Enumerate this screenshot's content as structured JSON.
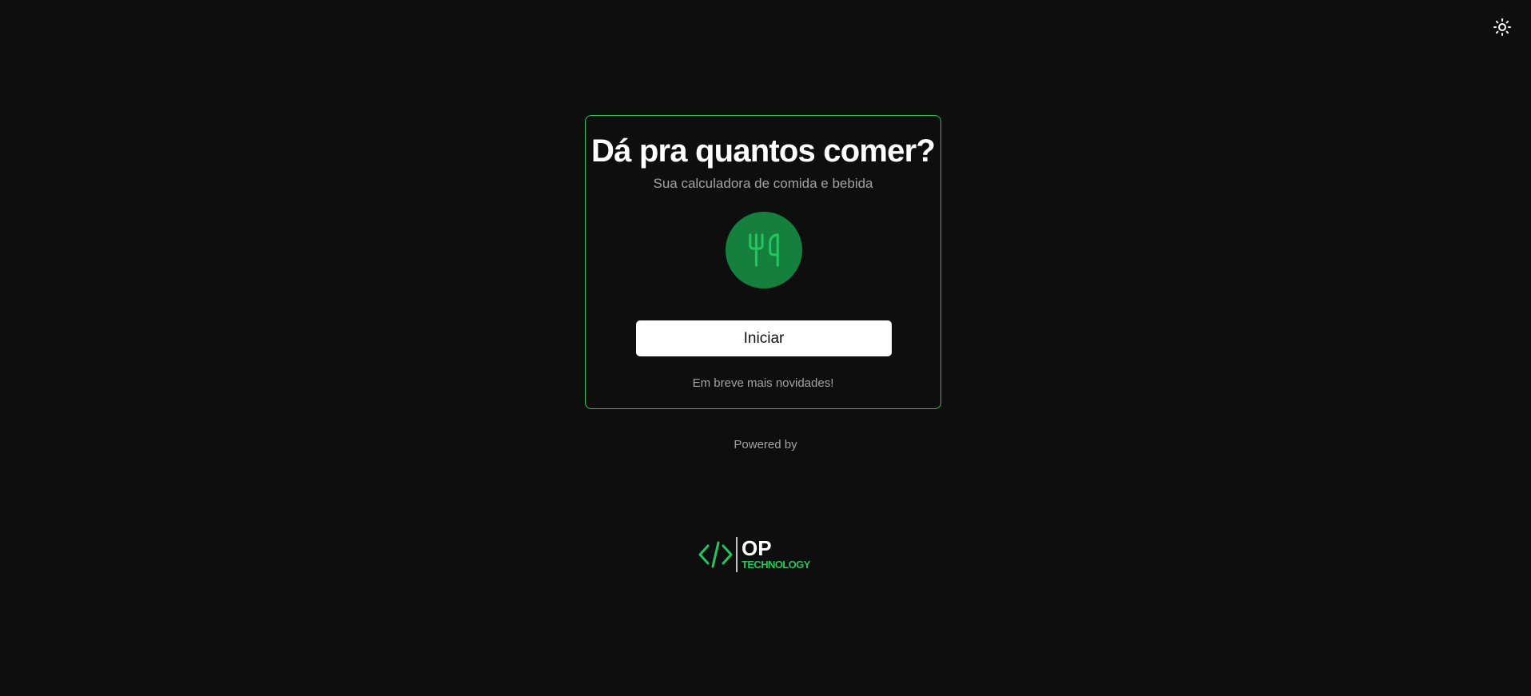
{
  "header": {
    "theme_toggle_icon": "sun-icon"
  },
  "card": {
    "title": "Dá pra quantos comer?",
    "subtitle": "Sua calculadora de comida e bebida",
    "icon": "utensils-icon",
    "start_button_label": "Iniciar",
    "news_text": "Em breve mais novidades!"
  },
  "footer": {
    "powered_by": "Powered by",
    "logo": {
      "name": "OP",
      "tagline": "TECHNOLOGY"
    }
  },
  "colors": {
    "background": "#0e0e0e",
    "accent": "#22c55e",
    "icon_circle": "#15803d",
    "button": "#ffffff"
  }
}
